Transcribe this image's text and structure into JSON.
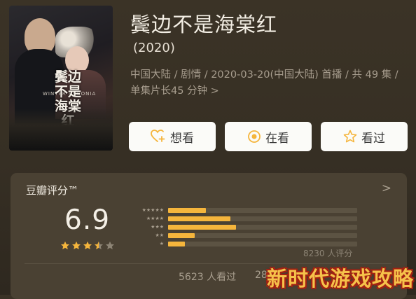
{
  "movie": {
    "title": "鬓边不是海棠红",
    "year": "(2020)",
    "meta": "中国大陆 / 剧情 / 2020-03-20(中国大陆) 首播 / 共 49 集 / 单集片长45 分钟",
    "meta_chevron": ">",
    "poster_title": "鬓边不是海棠红",
    "poster_en": "WINTER BEGONIA"
  },
  "actions": {
    "want": {
      "label": "想看",
      "icon": "heart-plus-icon"
    },
    "watching": {
      "label": "在看",
      "icon": "target-circle-icon"
    },
    "watched": {
      "label": "看过",
      "icon": "star-outline-icon"
    }
  },
  "rating": {
    "header": "豆瓣评分™",
    "chevron": ">",
    "score": "6.9",
    "stars_filled": 3.5,
    "stars_total": 5,
    "distribution": [
      {
        "stars": 5,
        "fraction": 0.2
      },
      {
        "stars": 4,
        "fraction": 0.33
      },
      {
        "stars": 3,
        "fraction": 0.36
      },
      {
        "stars": 2,
        "fraction": 0.14
      },
      {
        "stars": 1,
        "fraction": 0.09
      }
    ],
    "ratings_count": "8230 人评分",
    "bar_color": "#f5b53c",
    "star_color": "#f5b53c"
  },
  "footer": {
    "watched": "5623 人看过",
    "partial": "28"
  },
  "watermark": "新时代游戏攻略"
}
